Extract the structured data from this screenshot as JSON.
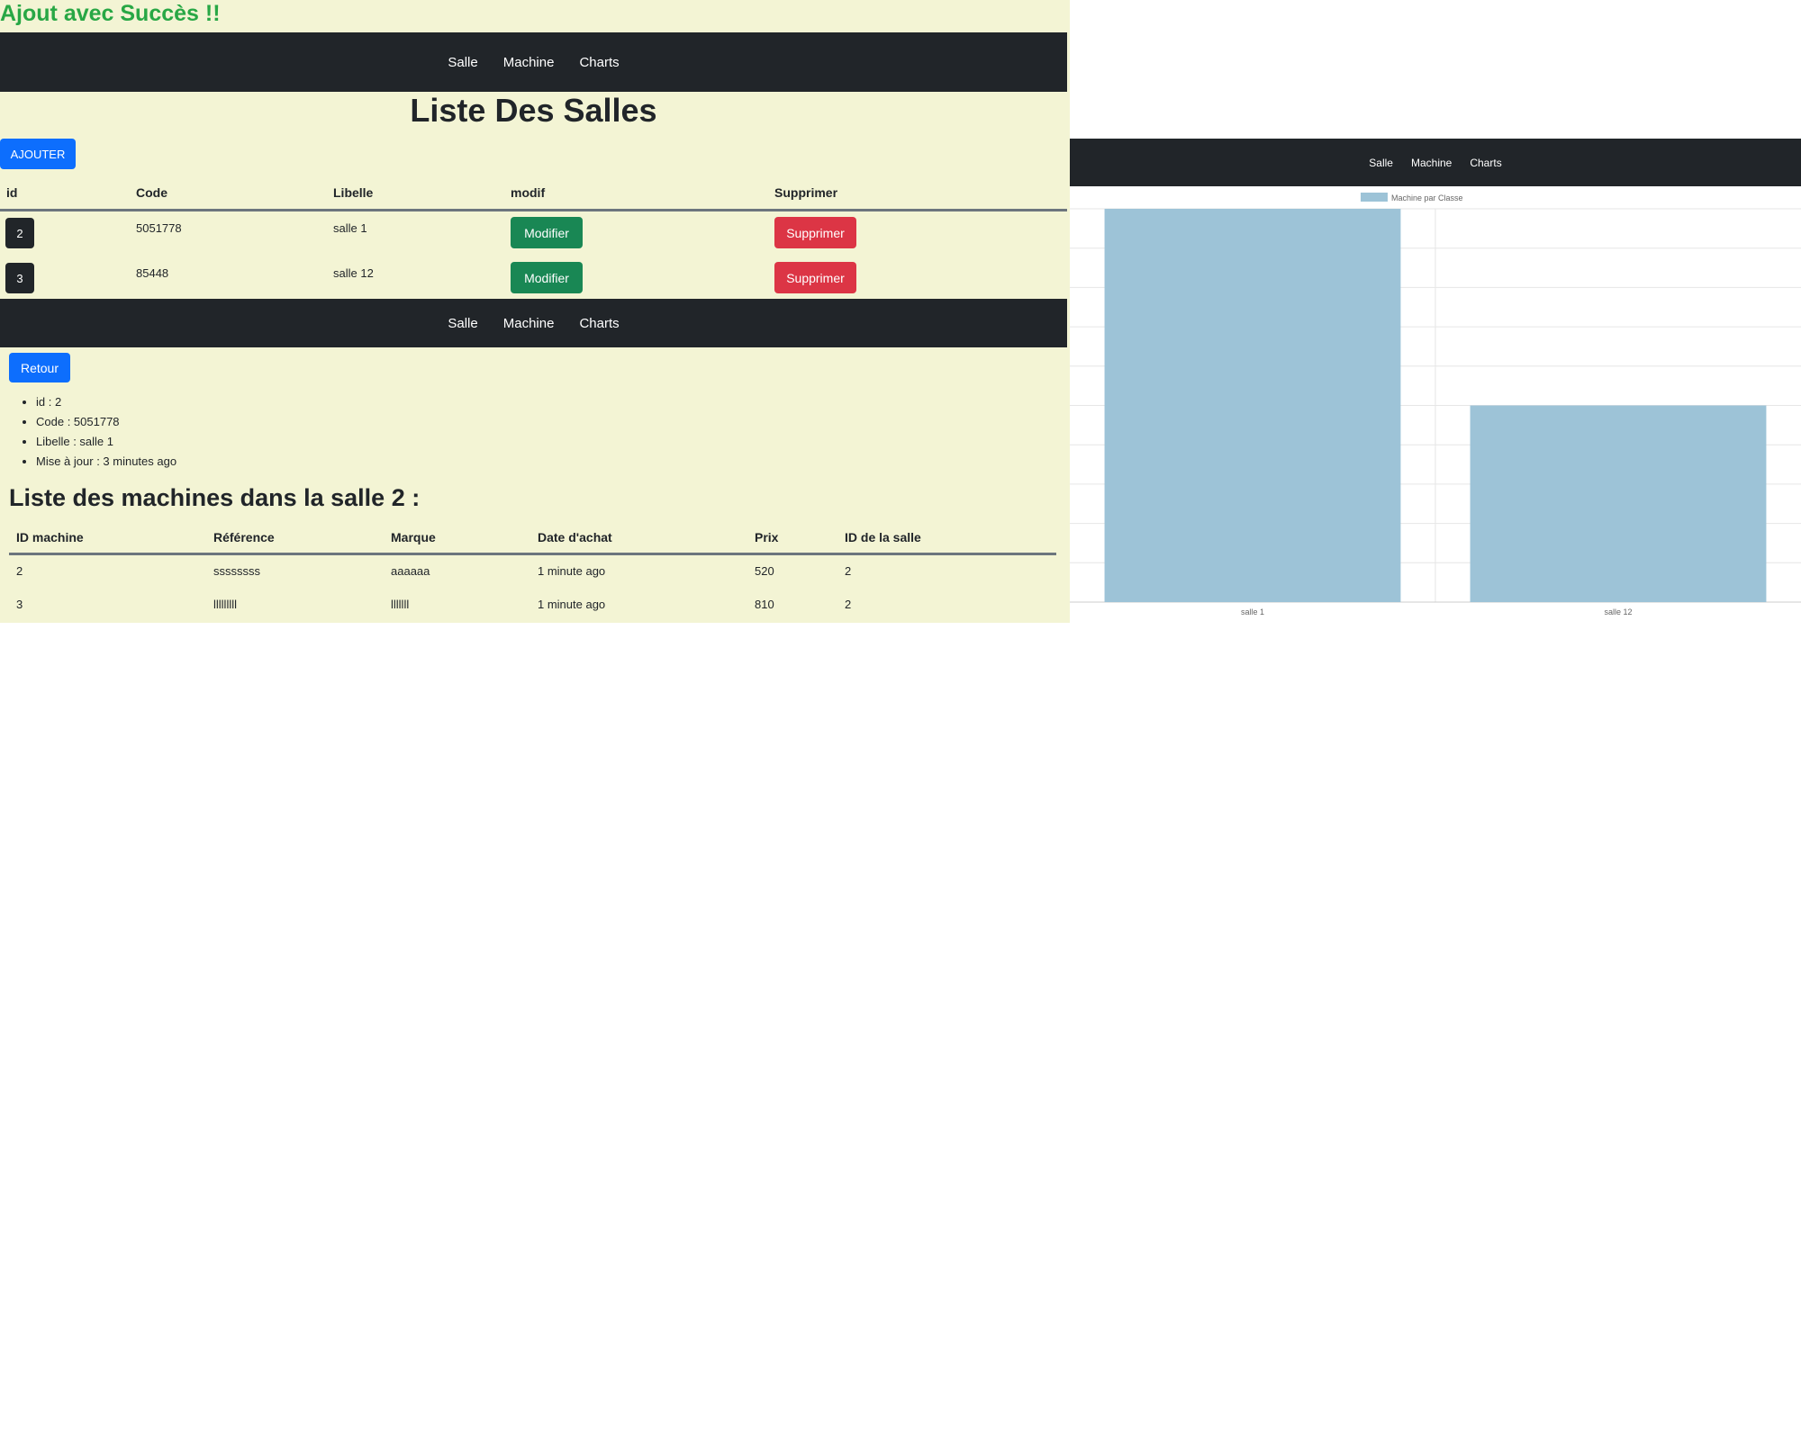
{
  "success_message": "Ajout avec Succès !!",
  "nav": {
    "items": [
      "Salle",
      "Machine",
      "Charts"
    ]
  },
  "salles_page": {
    "title": "Liste Des Salles",
    "add_button": "AJOUTER",
    "columns": [
      "id",
      "Code",
      "Libelle",
      "modif",
      "Supprimer"
    ],
    "rows": [
      {
        "id": "2",
        "code": "5051778",
        "libelle": "salle 1",
        "modif": "Modifier",
        "supprimer": "Supprimer"
      },
      {
        "id": "3",
        "code": "85448",
        "libelle": "salle 12",
        "modif": "Modifier",
        "supprimer": "Supprimer"
      }
    ]
  },
  "salle_detail": {
    "back_button": "Retour",
    "details": [
      "id : 2",
      "Code : 5051778",
      "Libelle : salle 1",
      "Mise à jour : 3 minutes ago"
    ],
    "machines_title": "Liste des machines dans la salle 2 :",
    "columns": [
      "ID machine",
      "Référence",
      "Marque",
      "Date d'achat",
      "Prix",
      "ID de la salle"
    ],
    "rows": [
      [
        "2",
        "ssssssss",
        "aaaaaa",
        "1 minute ago",
        "520",
        "2"
      ],
      [
        "3",
        "lllllllll",
        "lllllll",
        "1 minute ago",
        "810",
        "2"
      ]
    ]
  },
  "colors": {
    "page_bg": "#f3f4d4",
    "navbar": "#212529",
    "bar": "#9dc3d7",
    "success_text": "#28a745"
  },
  "chart_data": {
    "type": "bar",
    "categories": [
      "salle 1",
      "salle 12"
    ],
    "series": [
      {
        "name": "Machine par Classe",
        "values": [
          2,
          1
        ]
      }
    ],
    "ylim": [
      0,
      2
    ],
    "grid": true,
    "legend": "top-center"
  }
}
